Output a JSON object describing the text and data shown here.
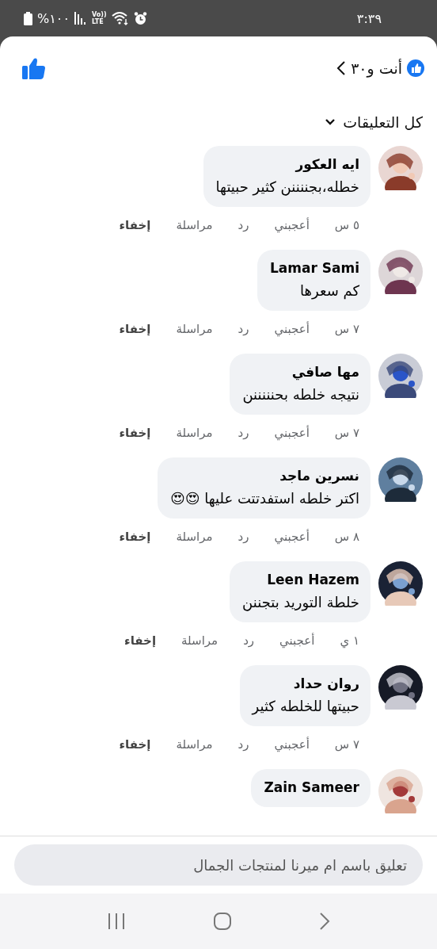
{
  "status_bar": {
    "time": "٣:٣٩",
    "battery": "%١٠٠",
    "network_top": "Vo))",
    "network_bottom": "LTE"
  },
  "header": {
    "reactions": "أنت و٣٠"
  },
  "filter": {
    "label": "كل التعليقات"
  },
  "comments": [
    {
      "name": "ايه العكور",
      "text": "خطله،بجننننن كثير حبيتها",
      "actions": [
        {
          "label": "٥ س",
          "strong": false
        },
        {
          "label": "أعجبني",
          "strong": false
        },
        {
          "label": "رد",
          "strong": false
        },
        {
          "label": "مراسلة",
          "strong": false
        },
        {
          "label": "إخفاء",
          "strong": true
        }
      ]
    },
    {
      "name": "Lamar Sami",
      "text": "كم سعرها",
      "actions": [
        {
          "label": "٧ س",
          "strong": false
        },
        {
          "label": "أعجبني",
          "strong": false
        },
        {
          "label": "رد",
          "strong": false
        },
        {
          "label": "مراسلة",
          "strong": false
        },
        {
          "label": "إخفاء",
          "strong": true
        }
      ]
    },
    {
      "name": "مها صافي",
      "text": "نتيجه خلطه بحنننننن",
      "actions": [
        {
          "label": "٧ س",
          "strong": false
        },
        {
          "label": "أعجبني",
          "strong": false
        },
        {
          "label": "رد",
          "strong": false
        },
        {
          "label": "مراسلة",
          "strong": false
        },
        {
          "label": "إخفاء",
          "strong": true
        }
      ]
    },
    {
      "name": "نسرين ماجد",
      "text": "اكتر خلطه استفدتتت عليها 😍😍",
      "actions": [
        {
          "label": "٨ س",
          "strong": false
        },
        {
          "label": "أعجبني",
          "strong": false
        },
        {
          "label": "رد",
          "strong": false
        },
        {
          "label": "مراسلة",
          "strong": false
        },
        {
          "label": "إخفاء",
          "strong": true
        }
      ]
    },
    {
      "name": "Leen Hazem",
      "text": "خلطة التوريد بتجننن",
      "actions": [
        {
          "label": "١ ي",
          "strong": false
        },
        {
          "label": "أعجبني",
          "strong": false
        },
        {
          "label": "رد",
          "strong": false
        },
        {
          "label": "مراسلة",
          "strong": false
        },
        {
          "label": "إخفاء",
          "strong": true
        }
      ]
    },
    {
      "name": "روان حداد",
      "text": "حبيتها للخلطه كثير",
      "actions": [
        {
          "label": "٧ س",
          "strong": false
        },
        {
          "label": "أعجبني",
          "strong": false
        },
        {
          "label": "رد",
          "strong": false
        },
        {
          "label": "مراسلة",
          "strong": false
        },
        {
          "label": "إخفاء",
          "strong": true
        }
      ]
    },
    {
      "name": "Zain Sameer"
    }
  ],
  "composer": {
    "placeholder": "تعليق باسم ام ميرنا لمنتجات الجمال"
  }
}
